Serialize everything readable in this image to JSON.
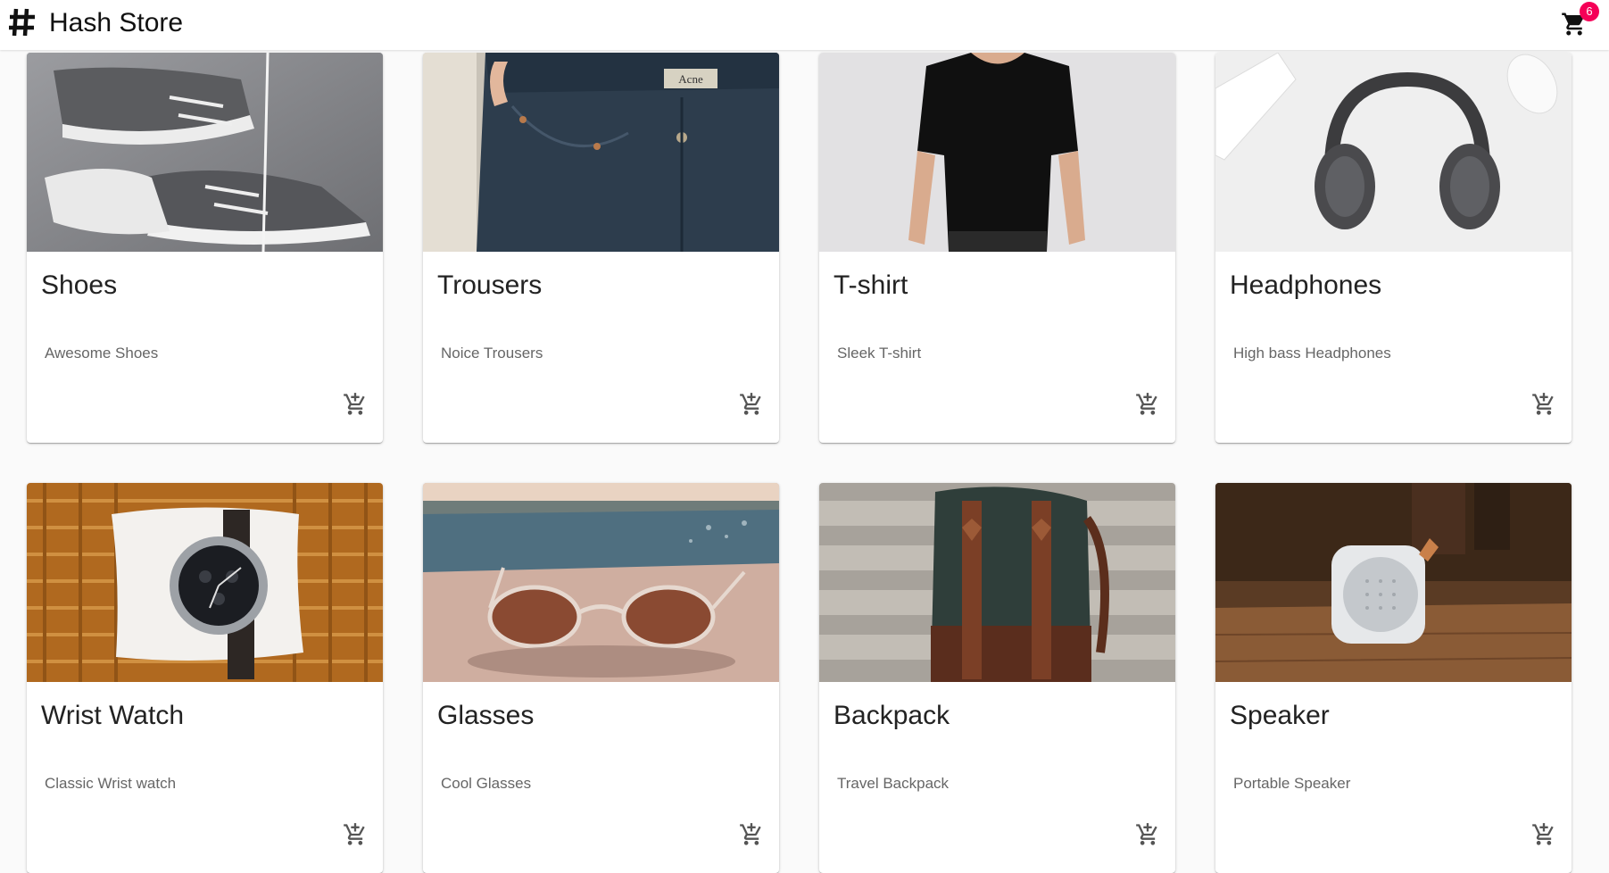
{
  "header": {
    "logo_icon": "hash-icon",
    "title": "Hash Store",
    "cart_icon": "shopping-cart-icon",
    "cart_count": "6",
    "badge_color": "#f50057"
  },
  "products": [
    {
      "name": "Shoes",
      "description": "Awesome Shoes",
      "image": "gray canvas sneakers"
    },
    {
      "name": "Trousers",
      "description": "Noice Trousers",
      "image": "dark denim jeans"
    },
    {
      "name": "T-shirt",
      "description": "Sleek T-shirt",
      "image": "black t-shirt"
    },
    {
      "name": "Headphones",
      "description": "High bass Headphones",
      "image": "over-ear headphones"
    },
    {
      "name": "Wrist Watch",
      "description": "Classic Wrist watch",
      "image": "wrist watch on pillow"
    },
    {
      "name": "Glasses",
      "description": "Cool Glasses",
      "image": "sunglasses by the sea"
    },
    {
      "name": "Backpack",
      "description": "Travel Backpack",
      "image": "green canvas backpack"
    },
    {
      "name": "Speaker",
      "description": "Portable Speaker",
      "image": "white portable speaker"
    }
  ],
  "add_to_cart_icon": "add-shopping-cart-icon"
}
